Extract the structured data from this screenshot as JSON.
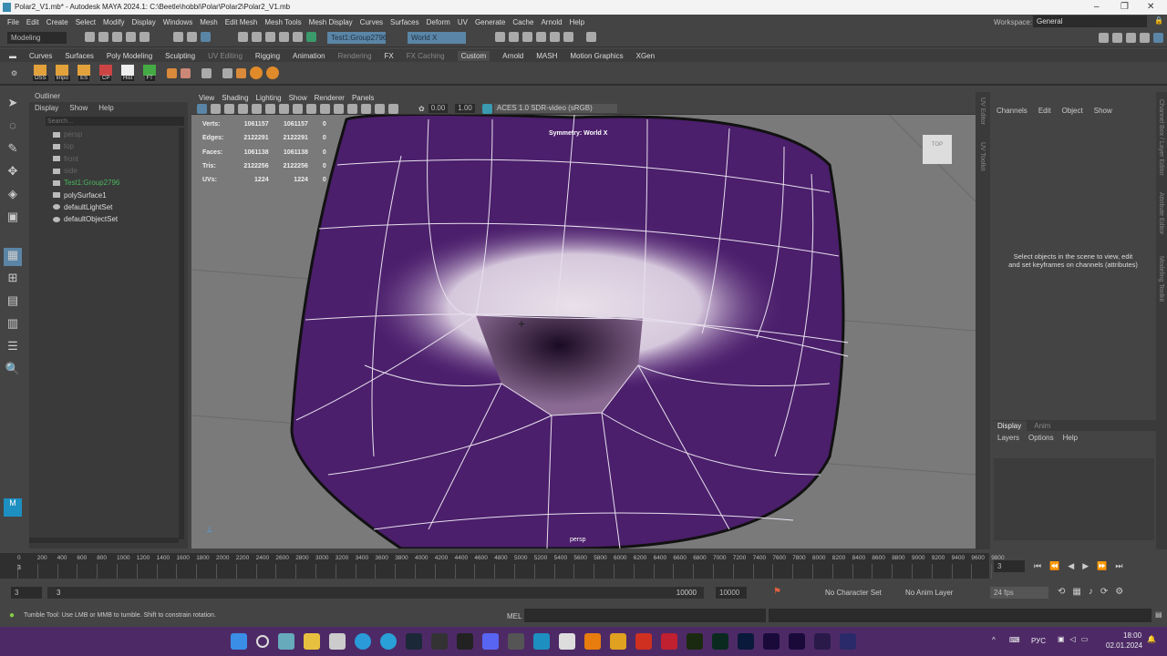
{
  "title": "Polar2_V1.mb* - Autodesk MAYA 2024.1: C:\\Beetle\\hobbi\\Polar\\Polar2\\Polar2_V1.mb",
  "menu": [
    "File",
    "Edit",
    "Create",
    "Select",
    "Modify",
    "Display",
    "Windows",
    "Mesh",
    "Edit Mesh",
    "Mesh Tools",
    "Mesh Display",
    "Curves",
    "Surfaces",
    "Deform",
    "UV",
    "Generate",
    "Cache",
    "Arnold",
    "Help"
  ],
  "workspace": {
    "label": "Workspace:",
    "value": "General"
  },
  "statusline": {
    "mode": "Modeling",
    "selection_field": "Test1:Group2796",
    "symmetry_field": "World X"
  },
  "shelf_tabs": [
    "Curves",
    "Surfaces",
    "Poly Modeling",
    "Sculpting",
    "UV Editing",
    "Rigging",
    "Animation",
    "Rendering",
    "FX",
    "FX Caching",
    "Custom",
    "Arnold",
    "MASH",
    "Motion Graphics",
    "XGen"
  ],
  "shelf_buttons": [
    "OSS",
    "Impo",
    "ES",
    "CP",
    "Hist",
    "FT"
  ],
  "outliner": {
    "title": "Outliner",
    "menu": [
      "Display",
      "Show",
      "Help"
    ],
    "search_placeholder": "Search...",
    "items": [
      {
        "label": "persp",
        "state": "dim"
      },
      {
        "label": "top",
        "state": "dim"
      },
      {
        "label": "front",
        "state": "dim"
      },
      {
        "label": "side",
        "state": "dim"
      },
      {
        "label": "Test1:Group2796",
        "state": "grn"
      },
      {
        "label": "polySurface1",
        "state": ""
      },
      {
        "label": "defaultLightSet",
        "state": ""
      },
      {
        "label": "defaultObjectSet",
        "state": ""
      }
    ]
  },
  "viewport": {
    "menu": [
      "View",
      "Shading",
      "Lighting",
      "Show",
      "Renderer",
      "Panels"
    ],
    "exposure": "0.00",
    "gamma": "1.00",
    "colorspace": "ACES 1.0 SDR-video (sRGB)",
    "symmetry_label": "Symmetry: World X",
    "camera_label": "persp",
    "viewcube": "TOP",
    "hud": [
      {
        "k": "Verts:",
        "a": "1061157",
        "b": "1061157",
        "c": "0"
      },
      {
        "k": "Edges:",
        "a": "2122291",
        "b": "2122291",
        "c": "0"
      },
      {
        "k": "Faces:",
        "a": "1061138",
        "b": "1061138",
        "c": "0"
      },
      {
        "k": "Tris:",
        "a": "2122256",
        "b": "2122256",
        "c": "0"
      },
      {
        "k": "UVs:",
        "a": "1224",
        "b": "1224",
        "c": "0"
      }
    ]
  },
  "side_tabs": [
    "UV Editor",
    "UV Toolkit",
    "Channel Box / Layer Editor",
    "Attribute Editor",
    "Modeling Toolkit"
  ],
  "channelbox": {
    "menu": [
      "Channels",
      "Edit",
      "Object",
      "Show"
    ],
    "message": "Select objects in the scene to view, edit and set keyframes on channels (attributes)"
  },
  "layers": {
    "tabs": [
      "Display",
      "Anim"
    ],
    "menu": [
      "Layers",
      "Options",
      "Help"
    ]
  },
  "timeline": {
    "ticks": [
      "0",
      "200",
      "400",
      "600",
      "800",
      "1000",
      "1200",
      "1400",
      "1600",
      "1800",
      "2000",
      "2200",
      "2400",
      "2600",
      "2800",
      "3000",
      "3200",
      "3400",
      "3600",
      "3800",
      "4000",
      "4200",
      "4400",
      "4600",
      "4800",
      "5000",
      "5200",
      "5400",
      "5600",
      "5800",
      "6000",
      "6200",
      "6400",
      "6600",
      "6800",
      "7000",
      "7200",
      "7400",
      "7600",
      "7800",
      "8000",
      "8200",
      "8400",
      "8600",
      "8800",
      "9000",
      "9200",
      "9400",
      "9600",
      "9800"
    ],
    "current_frame": "3",
    "current_field": "3"
  },
  "range": {
    "start": "3",
    "inner_start": "3",
    "inner_end": "10000",
    "end": "10000",
    "character_set": "No Character Set",
    "anim_layer": "No Anim Layer",
    "fps": "24 fps"
  },
  "command": {
    "help": "Tumble Tool: Use LMB or MMB to tumble. Shift to constrain rotation.",
    "lang": "MEL"
  },
  "taskbar": {
    "lang": "РУС",
    "time": "18:00",
    "date": "02.01.2024"
  },
  "colors": {
    "taskbar": "#4d2a66",
    "mesh": "#4b1f6b",
    "accent": "#5a85a6"
  }
}
